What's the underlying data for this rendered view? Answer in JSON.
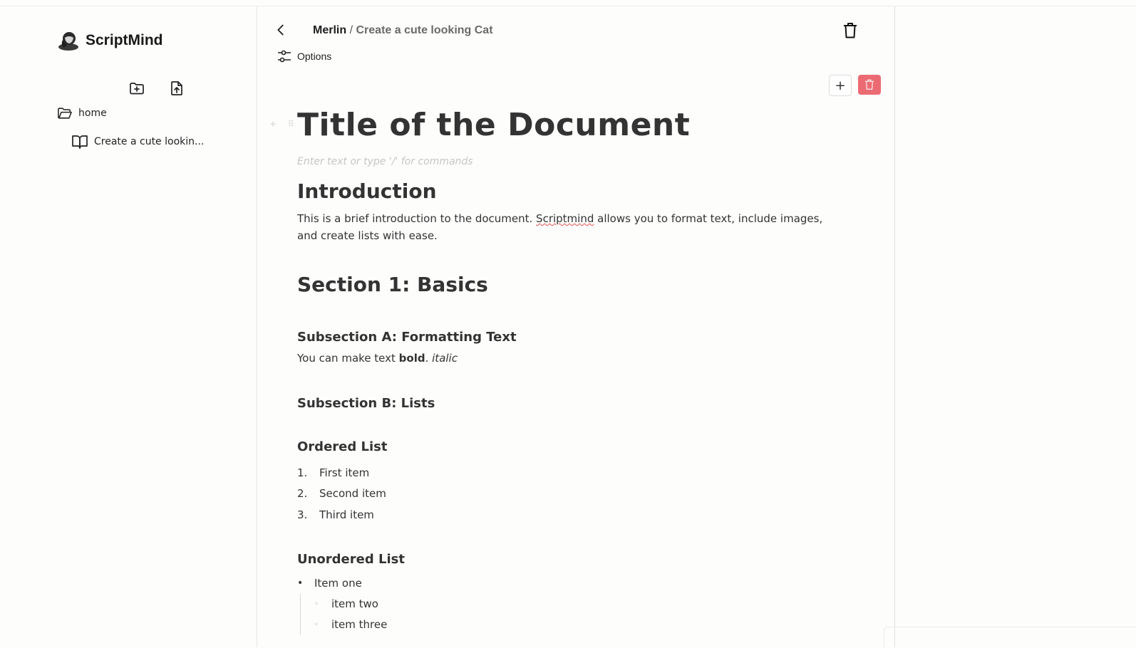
{
  "app": {
    "name": "ScriptMind"
  },
  "sidebar": {
    "new_folder_icon": "folder-plus-icon",
    "upload_icon": "file-upload-icon",
    "tree": {
      "folder": "home",
      "items": [
        {
          "label": "Create a cute lookin..."
        }
      ]
    }
  },
  "header": {
    "breadcrumb_root": "Merlin",
    "breadcrumb_sep": "/",
    "breadcrumb_current": "Create a cute looking Cat",
    "options_label": "Options"
  },
  "toolbar": {
    "add_label": "+"
  },
  "document": {
    "title": "Title of the Document",
    "placeholder": "Enter text or type '/' for commands",
    "intro_heading": "Introduction",
    "intro_text_before": "This is a brief introduction to the document. ",
    "intro_spell_word": "Scriptmind",
    "intro_text_after": " allows you to format text, include images, and create lists with ease.",
    "section1": "Section 1: Basics",
    "subsection_a": "Subsection A: Formatting Text",
    "formatting_prefix": "You can make text ",
    "formatting_bold": "bold",
    "formatting_sep": ". ",
    "formatting_italic": "italic",
    "subsection_b": "Subsection B: Lists",
    "ordered_heading": "Ordered List",
    "ordered_items": [
      {
        "num": "1.",
        "text": "First item"
      },
      {
        "num": "2.",
        "text": "Second item"
      },
      {
        "num": "3.",
        "text": "Third item"
      }
    ],
    "unordered_heading": "Unordered List",
    "unordered_item": "Item one",
    "unordered_nested": [
      "item two",
      "item three"
    ]
  },
  "colors": {
    "danger": "#ec6b73",
    "text": "#333333",
    "placeholder": "#c6c6c6"
  }
}
